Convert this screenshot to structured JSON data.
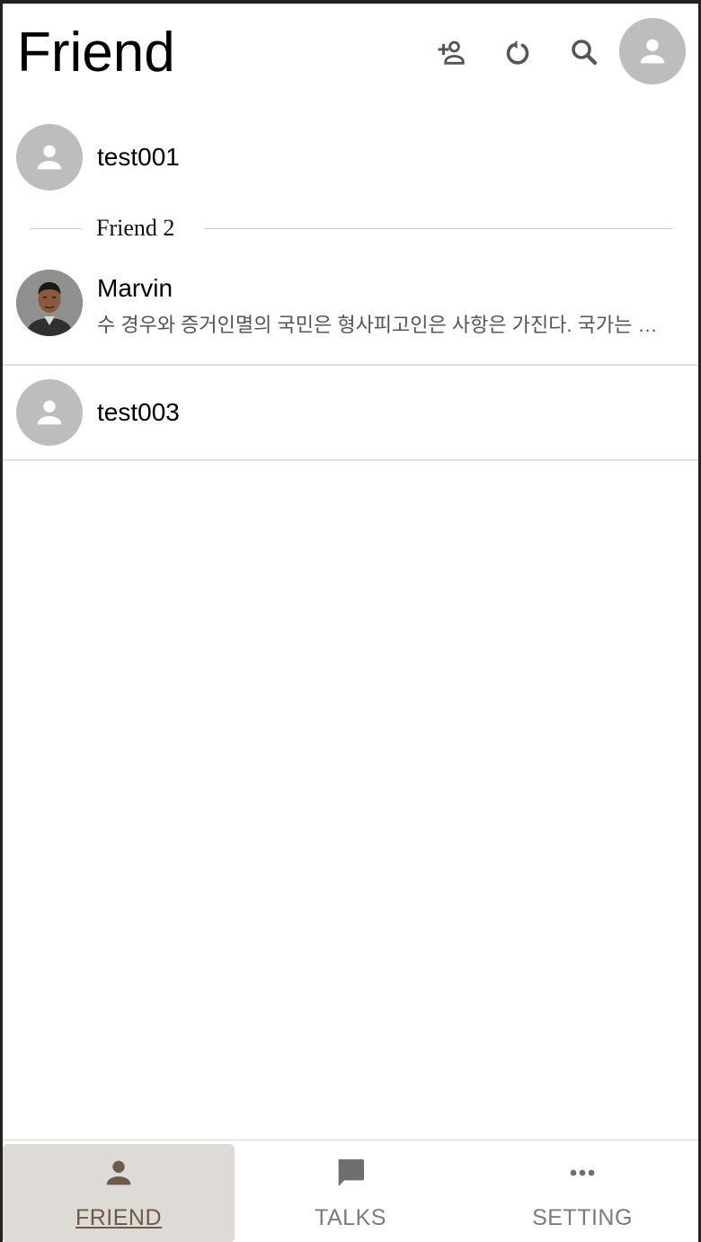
{
  "header": {
    "title": "Friend",
    "icons": [
      "add-friend-icon",
      "refresh-icon",
      "search-icon",
      "my-profile-icon"
    ]
  },
  "my_profile": {
    "name": "test001"
  },
  "group": {
    "label": "Friend 2"
  },
  "friends": [
    {
      "name": "Marvin",
      "status": "수 경우와 증거인멸의 국민은 형사피고인은 사항은 가진다. 국가는 모든 국민의 권리"
    },
    {
      "name": "test003",
      "status": ""
    }
  ],
  "nav": {
    "items": [
      {
        "label": "FRIEND",
        "icon": "person-icon",
        "active": true
      },
      {
        "label": "TALKS",
        "icon": "chat-icon",
        "active": false
      },
      {
        "label": "SETTING",
        "icon": "more-icon",
        "active": false
      }
    ]
  },
  "colors": {
    "icon_gray": "#555555",
    "avatar_bg": "#bdbdbd",
    "active_tab_bg": "#dedad6",
    "active_tab_text": "#6d5a49",
    "inactive_tab_text": "#7b7b7b"
  }
}
